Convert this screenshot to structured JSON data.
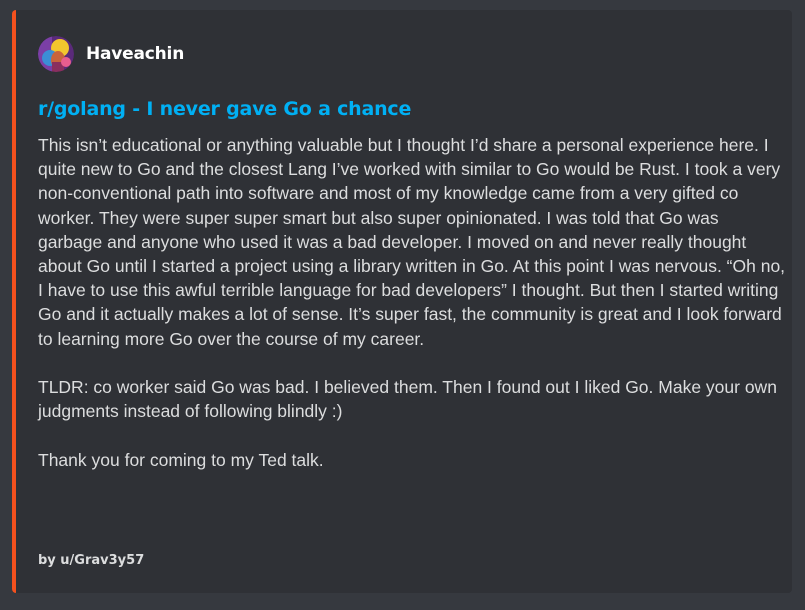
{
  "embed": {
    "accent_color": "#f4511e",
    "author": {
      "name": "Haveachin",
      "avatar_icon": "user-avatar-icon"
    },
    "title": "r/golang - I never gave Go a chance",
    "paragraphs": [
      "This isn’t educational or anything valuable but I thought I’d share a personal experience here. I quite new to Go and the closest Lang I’ve worked with similar to Go would be Rust. I took a very non-conventional path into software and most of my knowledge came from a very gifted co worker. They were super super smart but also super opinionated. I was told that Go was garbage and anyone who used it was a bad developer. I moved on and never really thought about Go until I started a project using a library written in Go. At this point I was nervous. “Oh no, I have to use this awful terrible language for bad developers” I thought. But then I started writing Go and it actually makes a lot of sense. It’s super fast, the community is great and I look forward to learning more Go over the course of my career.",
      "TLDR: co worker said Go was bad. I believed them. Then I found out I liked Go. Make your own judgments instead of following blindly :)",
      "Thank you for coming to my Ted talk."
    ],
    "footer": "by u/Grav3y57"
  }
}
